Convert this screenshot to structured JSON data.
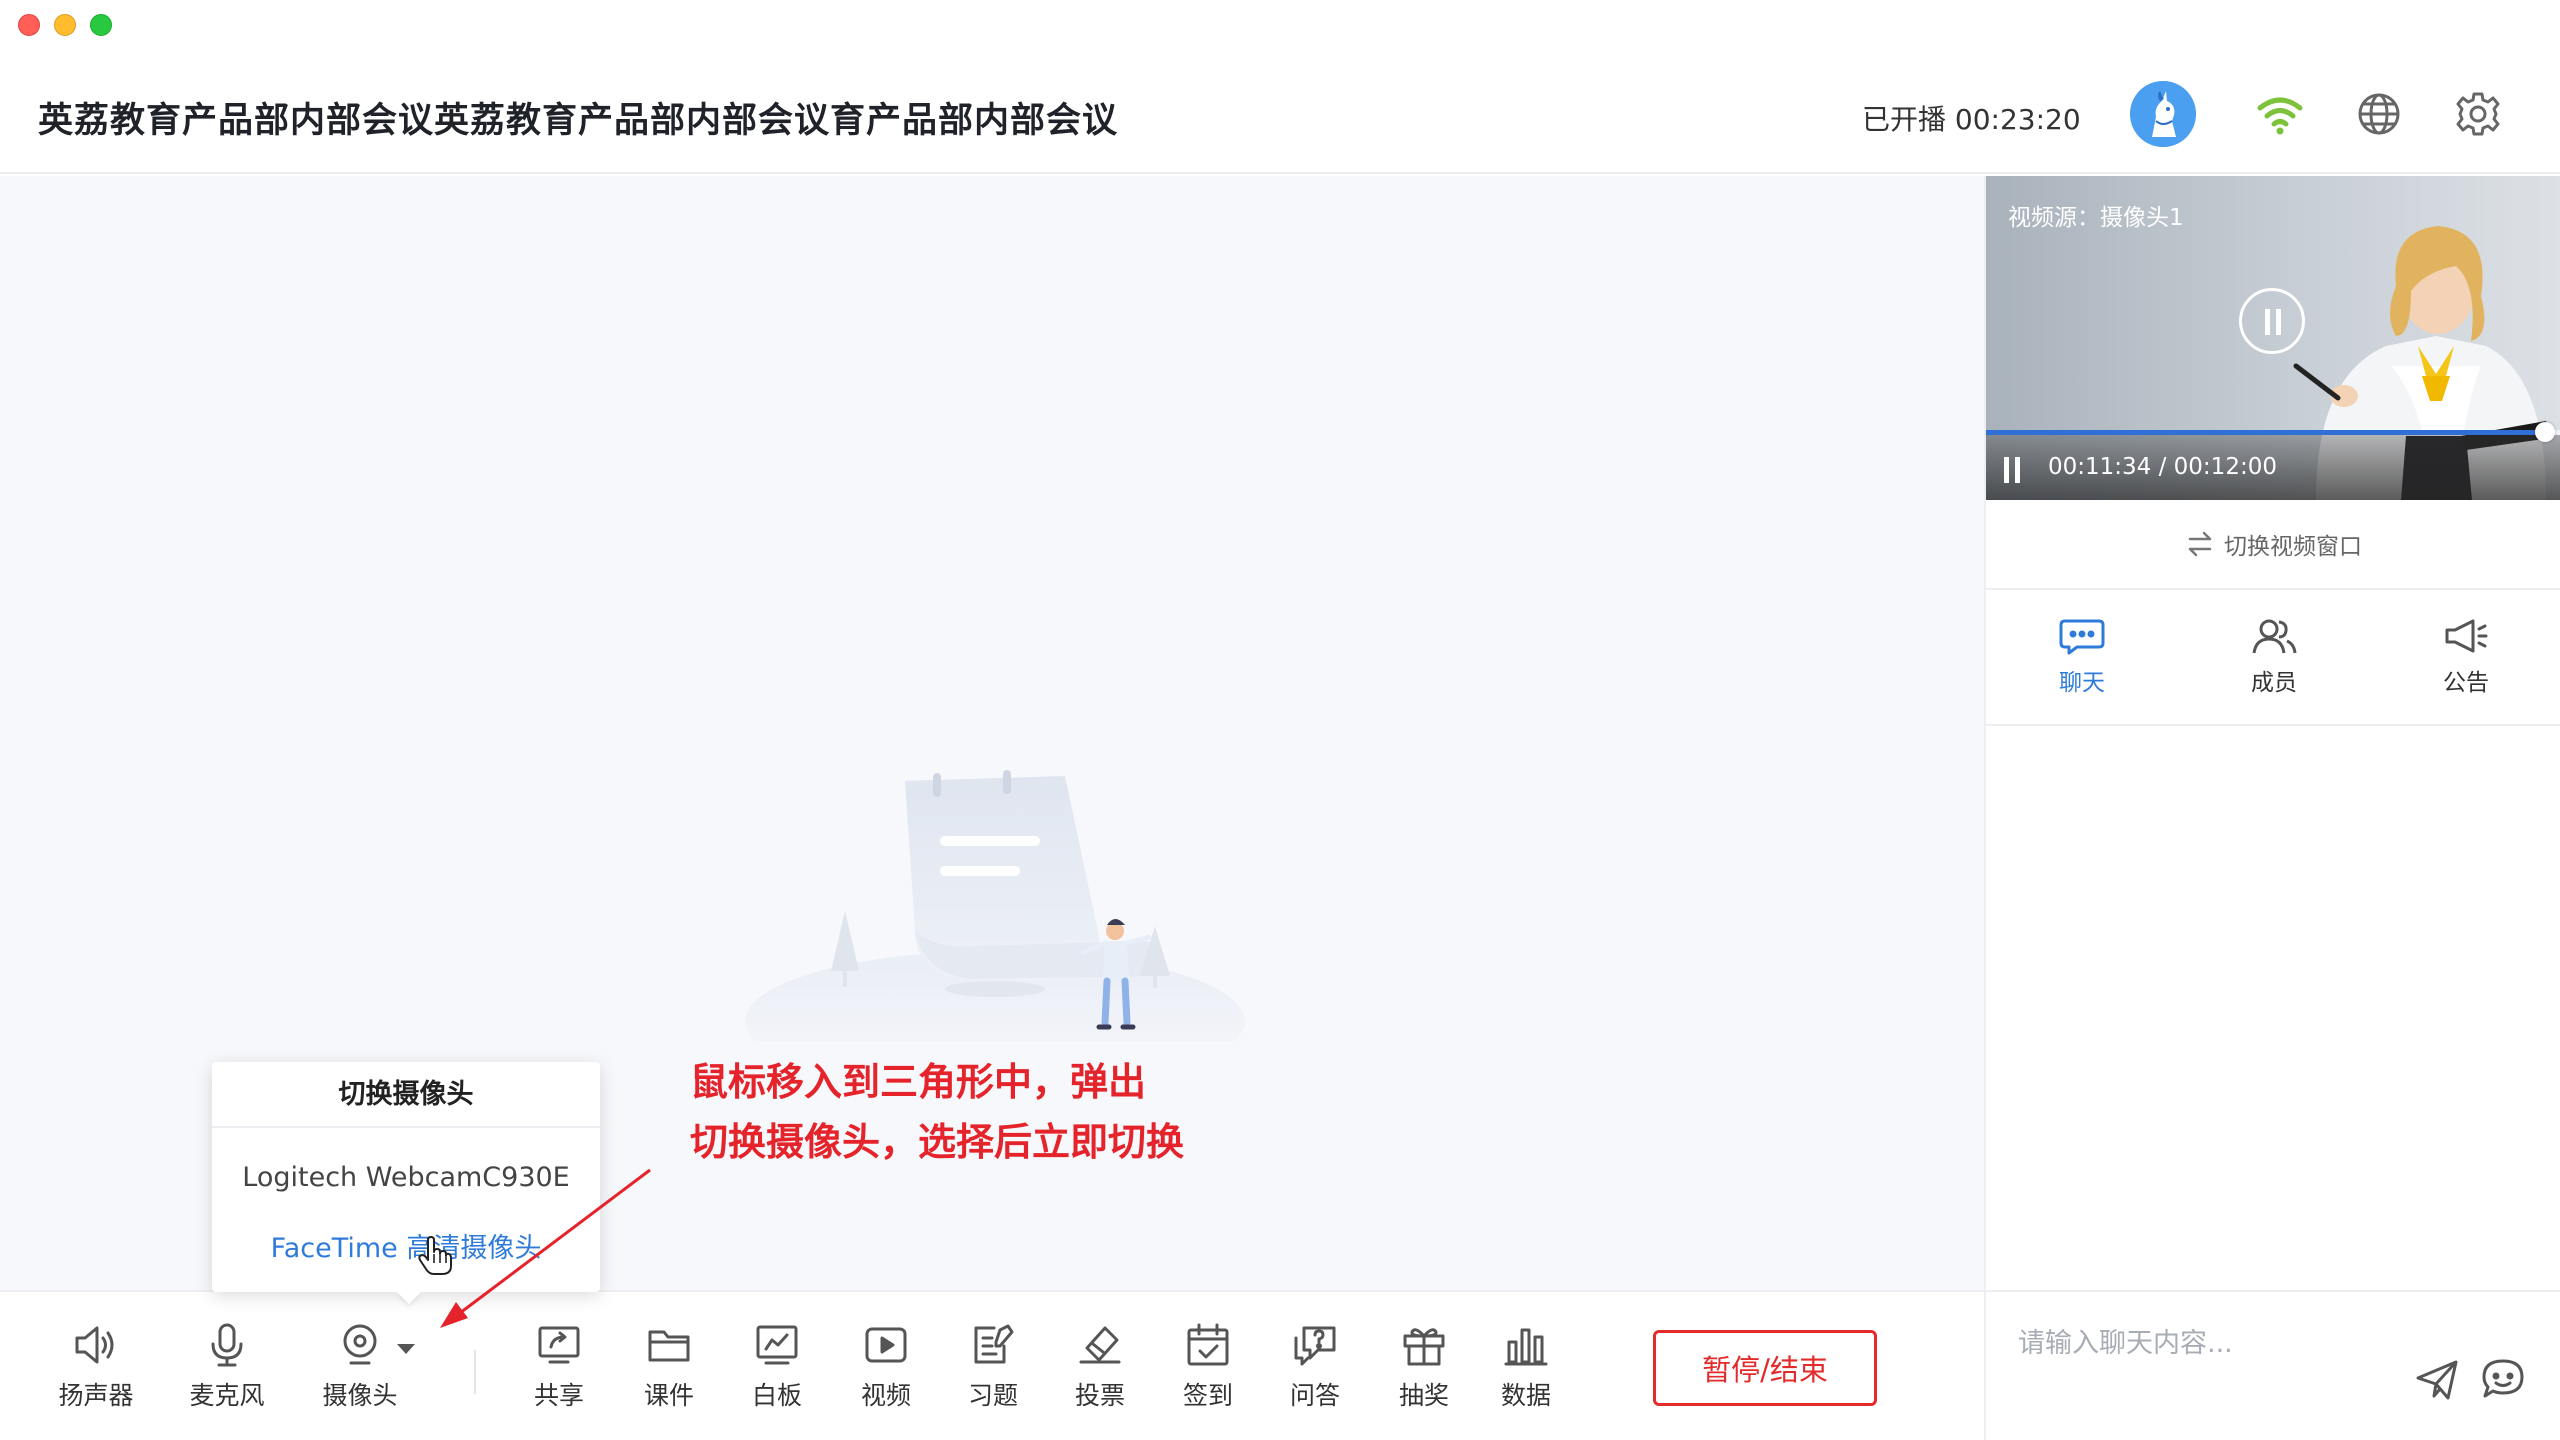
{
  "header": {
    "title": "英荔教育产品部内部会议英荔教育产品部内部会议育产品部内部会议",
    "live_status": "已开播 00:23:20"
  },
  "video": {
    "source_label": "视频源：摄像头1",
    "time": "00:11:34 / 00:12:00",
    "progress": 0.97
  },
  "sidebar": {
    "switch_window": "切换视频窗口",
    "tabs": [
      {
        "label": "聊天",
        "icon": "chat-icon",
        "active": true
      },
      {
        "label": "成员",
        "icon": "members-icon",
        "active": false
      },
      {
        "label": "公告",
        "icon": "announcement-icon",
        "active": false
      }
    ],
    "chat_placeholder": "请输入聊天内容..."
  },
  "toolbar": {
    "speaker": "扬声器",
    "microphone": "麦克风",
    "camera": "摄像头",
    "share": "共享",
    "courseware": "课件",
    "whiteboard": "白板",
    "video": "视频",
    "exercise": "习题",
    "vote": "投票",
    "checkin": "签到",
    "qa": "问答",
    "lottery": "抽奖",
    "data": "数据",
    "end_button": "暂停/结束"
  },
  "camera_popup": {
    "title": "切换摄像头",
    "options": [
      "Logitech WebcamC930E",
      "FaceTime 高清摄像头"
    ],
    "selected_index": 1
  },
  "annotation": {
    "line1": "鼠标移入到三角形中，弹出",
    "line2": "切换摄像头，选择后立即切换"
  },
  "colors": {
    "accent": "#2f7bd9",
    "danger": "#e32b2b",
    "wifi": "#7cc23b"
  }
}
